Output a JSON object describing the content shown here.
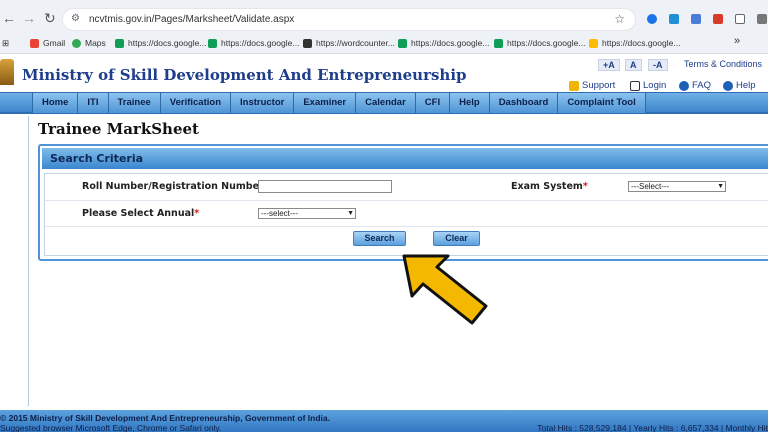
{
  "browser": {
    "url": "ncvtmis.gov.in/Pages/Marksheet/Validate.aspx",
    "bookmarks": [
      {
        "label": "Gmail",
        "icon": "gmail-icon",
        "color": "#ea4335"
      },
      {
        "label": "Maps",
        "icon": "maps-icon",
        "color": "#34a853"
      },
      {
        "label": "https://docs.google...",
        "icon": "sheets-icon",
        "color": "#0f9d58"
      },
      {
        "label": "https://docs.google...",
        "icon": "sheets-icon",
        "color": "#0f9d58"
      },
      {
        "label": "https://wordcounter...",
        "icon": "wordcounter-icon",
        "color": "#333333"
      },
      {
        "label": "https://docs.google...",
        "icon": "sheets-icon",
        "color": "#0f9d58"
      },
      {
        "label": "https://docs.google...",
        "icon": "sheets-icon",
        "color": "#0f9d58"
      },
      {
        "label": "https://docs.google...",
        "icon": "drive-icon",
        "color": "#fbbc04"
      }
    ],
    "more": "»"
  },
  "site": {
    "title": "Ministry of Skill Development And Entrepreneurship",
    "font_sizes": [
      "+A",
      "A",
      "-A"
    ],
    "terms": "Terms & Conditions",
    "links": {
      "support": "Support",
      "login": "Login",
      "faq": "FAQ",
      "help": "Help"
    }
  },
  "menu": [
    "Home",
    "ITI",
    "Trainee",
    "Verification",
    "Instructor",
    "Examiner",
    "Calendar",
    "CFI",
    "Help",
    "Dashboard",
    "Complaint Tool"
  ],
  "page": {
    "title": "Trainee MarkSheet",
    "panel_title": "Search Criteria",
    "roll_label": "Roll Number/Registration Number",
    "exam_label": "Exam System",
    "exam_value": "---Select---",
    "annual_label": "Please Select Annual",
    "annual_value": "---select---",
    "required_mark": "*",
    "search_button": "Search",
    "clear_button": "Clear"
  },
  "footer": {
    "copyright": "© 2015 Ministry of Skill Development And Entrepreneurship, Government of India.",
    "browsers": "Suggested browser Microsoft Edge, Chrome or Safari only.",
    "hits": "Total Hits : 528,529,184 | Yearly Hits : 6,657,334 | Monthly Hit"
  },
  "colors": {
    "accent": "#3a86cf",
    "brand": "#1e3d8a",
    "arrow": "#f5b800"
  }
}
